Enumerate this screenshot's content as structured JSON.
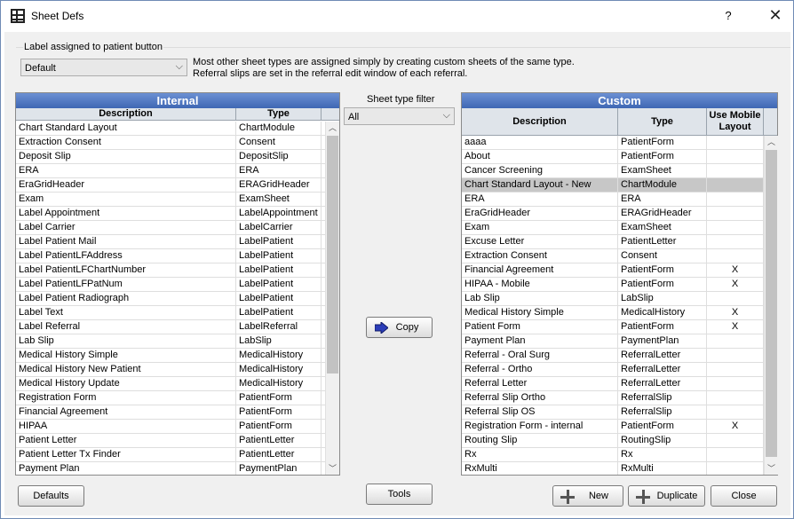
{
  "window": {
    "title": "Sheet Defs",
    "help": "?",
    "close": "✕"
  },
  "label_group": {
    "label": "Label assigned to patient button",
    "selected": "Default",
    "info_line1": "Most other sheet types are assigned simply by creating custom sheets of the same type.",
    "info_line2": "Referral slips are set in the referral edit window of each referral."
  },
  "internal": {
    "title": "Internal",
    "col_desc": "Description",
    "col_type": "Type",
    "rows": [
      [
        "Chart Standard Layout",
        "ChartModule"
      ],
      [
        "Extraction Consent",
        "Consent"
      ],
      [
        "Deposit Slip",
        "DepositSlip"
      ],
      [
        "ERA",
        "ERA"
      ],
      [
        "EraGridHeader",
        "ERAGridHeader"
      ],
      [
        "Exam",
        "ExamSheet"
      ],
      [
        "Label Appointment",
        "LabelAppointment"
      ],
      [
        "Label Carrier",
        "LabelCarrier"
      ],
      [
        "Label Patient Mail",
        "LabelPatient"
      ],
      [
        "Label PatientLFAddress",
        "LabelPatient"
      ],
      [
        "Label PatientLFChartNumber",
        "LabelPatient"
      ],
      [
        "Label PatientLFPatNum",
        "LabelPatient"
      ],
      [
        "Label Patient Radiograph",
        "LabelPatient"
      ],
      [
        "Label Text",
        "LabelPatient"
      ],
      [
        "Label Referral",
        "LabelReferral"
      ],
      [
        "Lab Slip",
        "LabSlip"
      ],
      [
        "Medical History Simple",
        "MedicalHistory"
      ],
      [
        "Medical History New Patient",
        "MedicalHistory"
      ],
      [
        "Medical History Update",
        "MedicalHistory"
      ],
      [
        "Registration Form",
        "PatientForm"
      ],
      [
        "Financial Agreement",
        "PatientForm"
      ],
      [
        "HIPAA",
        "PatientForm"
      ],
      [
        "Patient Letter",
        "PatientLetter"
      ],
      [
        "Patient Letter Tx Finder",
        "PatientLetter"
      ],
      [
        "Payment Plan",
        "PaymentPlan"
      ]
    ]
  },
  "filter": {
    "label": "Sheet type filter",
    "selected": "All"
  },
  "custom": {
    "title": "Custom",
    "col_desc": "Description",
    "col_type": "Type",
    "col_mobile": "Use Mobile Layout",
    "rows": [
      [
        "aaaa",
        "PatientForm",
        ""
      ],
      [
        "About",
        "PatientForm",
        ""
      ],
      [
        "Cancer Screening",
        "ExamSheet",
        ""
      ],
      [
        "Chart Standard Layout - New",
        "ChartModule",
        ""
      ],
      [
        "ERA",
        "ERA",
        ""
      ],
      [
        "EraGridHeader",
        "ERAGridHeader",
        ""
      ],
      [
        "Exam",
        "ExamSheet",
        ""
      ],
      [
        "Excuse Letter",
        "PatientLetter",
        ""
      ],
      [
        "Extraction Consent",
        "Consent",
        ""
      ],
      [
        "Financial Agreement",
        "PatientForm",
        "X"
      ],
      [
        "HIPAA - Mobile",
        "PatientForm",
        "X"
      ],
      [
        "Lab Slip",
        "LabSlip",
        ""
      ],
      [
        "Medical History Simple",
        "MedicalHistory",
        "X"
      ],
      [
        "Patient Form",
        "PatientForm",
        "X"
      ],
      [
        "Payment Plan",
        "PaymentPlan",
        ""
      ],
      [
        "Referral - Oral Surg",
        "ReferralLetter",
        ""
      ],
      [
        "Referral - Ortho",
        "ReferralLetter",
        ""
      ],
      [
        "Referral Letter",
        "ReferralLetter",
        ""
      ],
      [
        "Referral Slip Ortho",
        "ReferralSlip",
        ""
      ],
      [
        "Referral Slip OS",
        "ReferralSlip",
        ""
      ],
      [
        "Registration Form - internal",
        "PatientForm",
        "X"
      ],
      [
        "Routing Slip",
        "RoutingSlip",
        ""
      ],
      [
        "Rx",
        "Rx",
        ""
      ],
      [
        "RxMulti",
        "RxMulti",
        ""
      ]
    ],
    "selected_row": "Chart Standard Layout - New"
  },
  "buttons": {
    "copy": "Copy",
    "defaults": "Defaults",
    "tools": "Tools",
    "new": "New",
    "duplicate": "Duplicate",
    "close": "Close"
  }
}
